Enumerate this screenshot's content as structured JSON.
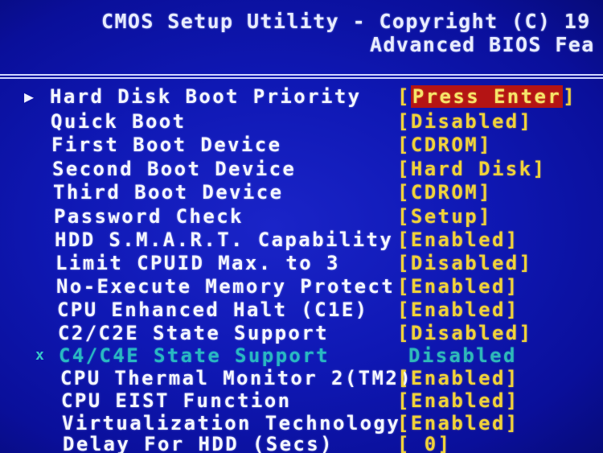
{
  "header": {
    "line1": "CMOS Setup Utility - Copyright (C) 19",
    "line2": "Advanced BIOS Fea"
  },
  "colors": {
    "background": "#0f18b4",
    "label_text": "#f4f6ff",
    "value_text": "#f0d23a",
    "selected_highlight": "#b41414",
    "disabled_text": "#29b8c2"
  },
  "items": [
    {
      "marker": "▶",
      "label": "Hard Disk Boot Priority",
      "value_prefix": "[",
      "value": "Press Enter",
      "value_suffix": "]"
    },
    {
      "marker": "",
      "label": "Quick Boot",
      "value_prefix": "[",
      "value": "Disabled",
      "value_suffix": "]"
    },
    {
      "marker": "",
      "label": "First Boot Device",
      "value_prefix": "[",
      "value": "CDROM",
      "value_suffix": "]"
    },
    {
      "marker": "",
      "label": "Second Boot Device",
      "value_prefix": "[",
      "value": "Hard Disk",
      "value_suffix": "]"
    },
    {
      "marker": "",
      "label": "Third Boot Device",
      "value_prefix": "[",
      "value": "CDROM",
      "value_suffix": "]"
    },
    {
      "marker": "",
      "label": "Password Check",
      "value_prefix": "[",
      "value": "Setup",
      "value_suffix": "]"
    },
    {
      "marker": "",
      "label": "HDD S.M.A.R.T. Capability",
      "value_prefix": "[",
      "value": "Enabled",
      "value_suffix": "]"
    },
    {
      "marker": "",
      "label": "Limit CPUID Max. to 3",
      "value_prefix": "[",
      "value": "Disabled",
      "value_suffix": "]"
    },
    {
      "marker": "",
      "label": "No-Execute Memory Protect",
      "value_prefix": "[",
      "value": "Enabled",
      "value_suffix": "]"
    },
    {
      "marker": "",
      "label": "CPU Enhanced Halt (C1E)",
      "value_prefix": "[",
      "value": "Enabled",
      "value_suffix": "]"
    },
    {
      "marker": "",
      "label": "C2/C2E State Support",
      "value_prefix": "[",
      "value": "Disabled",
      "value_suffix": "]"
    },
    {
      "marker": "x",
      "label": "C4/C4E State Support",
      "value_prefix": "",
      "value": "Disabled",
      "value_suffix": ""
    },
    {
      "marker": "",
      "label": "CPU Thermal Monitor 2(TM2)",
      "value_prefix": "[",
      "value": "Enabled",
      "value_suffix": "]"
    },
    {
      "marker": "",
      "label": "CPU EIST Function",
      "value_prefix": "[",
      "value": "Enabled",
      "value_suffix": "]"
    },
    {
      "marker": "",
      "label": "Virtualization Technology",
      "value_prefix": "[",
      "value": "Enabled",
      "value_suffix": "]"
    },
    {
      "marker": "",
      "label": "Delay For HDD (Secs)",
      "value_prefix": "[",
      "value": " 0",
      "value_suffix": "]"
    }
  ]
}
